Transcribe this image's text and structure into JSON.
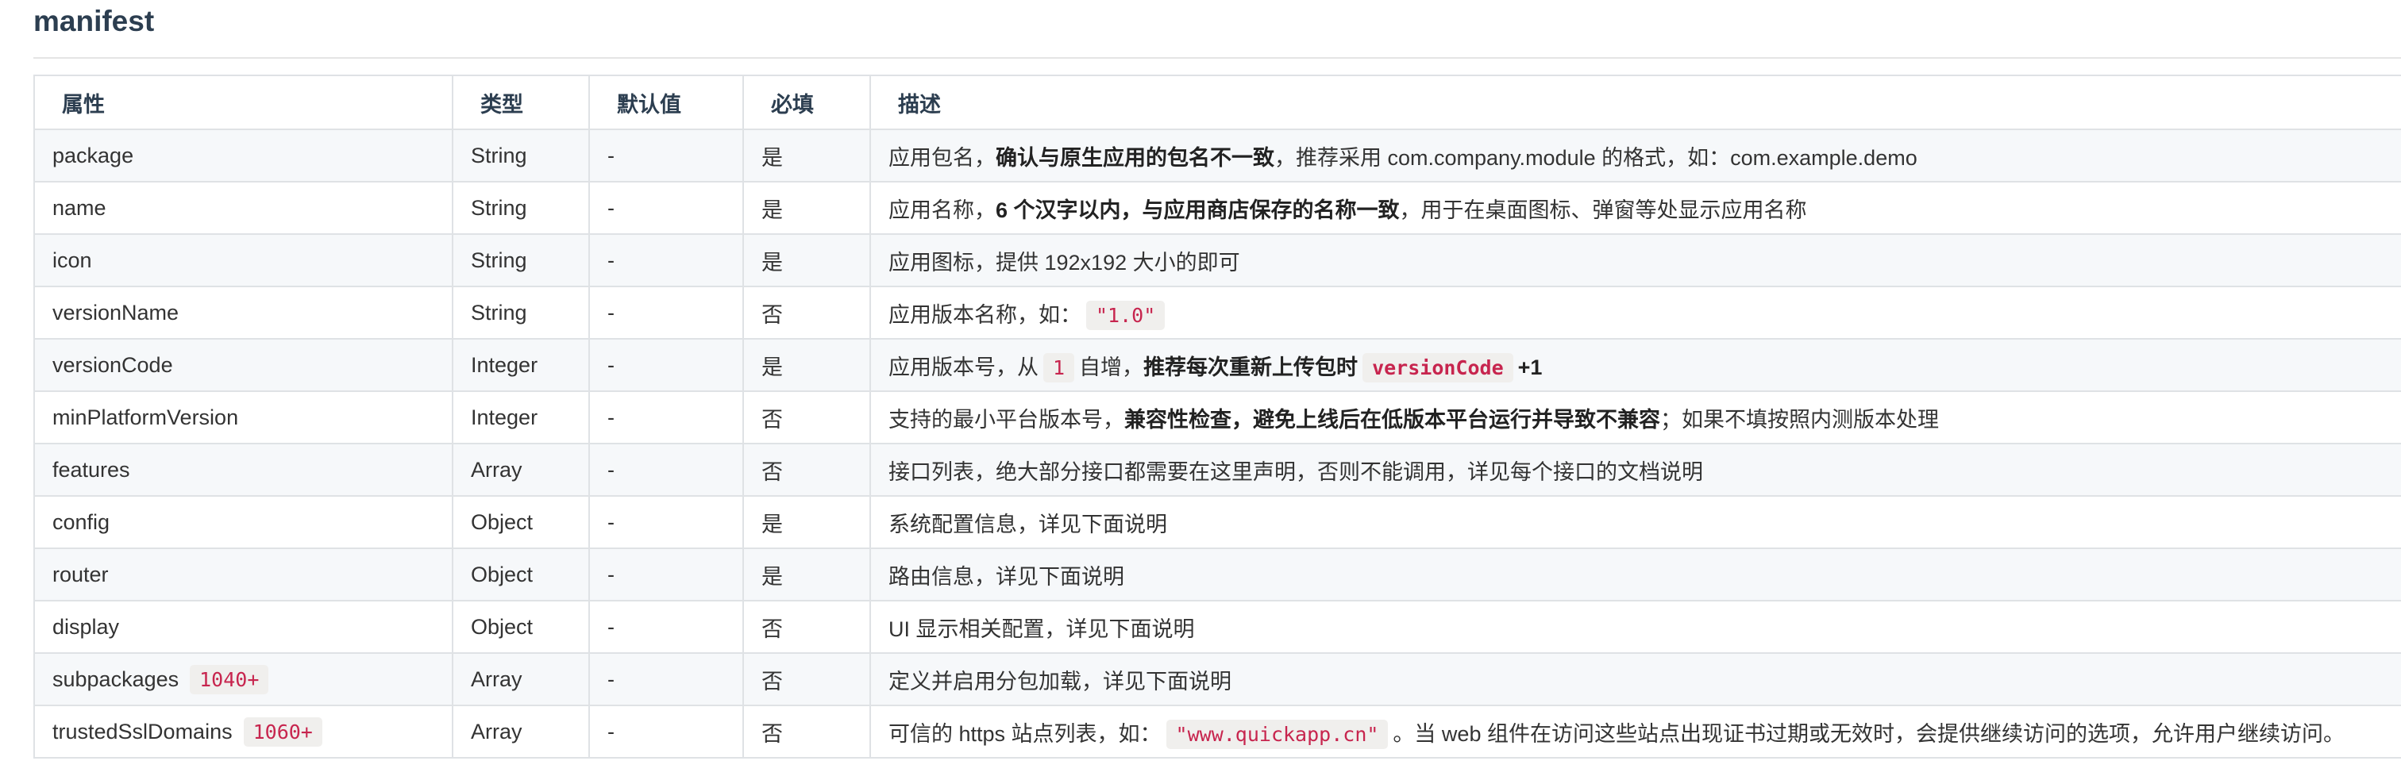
{
  "page": {
    "title": "manifest"
  },
  "table": {
    "headers": [
      "属性",
      "类型",
      "默认值",
      "必填",
      "描述"
    ],
    "rows": [
      {
        "property": "package",
        "type": "String",
        "default": "-",
        "required": "是",
        "desc": [
          {
            "text": "应用包名，"
          },
          {
            "text": "确认与原生应用的包名不一致",
            "bold": true
          },
          {
            "text": "，推荐采用 com.company.module 的格式，如：com.example.demo"
          }
        ]
      },
      {
        "property": "name",
        "type": "String",
        "default": "-",
        "required": "是",
        "desc": [
          {
            "text": "应用名称，"
          },
          {
            "text": "6 个汉字以内，与应用商店保存的名称一致",
            "bold": true
          },
          {
            "text": "，用于在桌面图标、弹窗等处显示应用名称"
          }
        ]
      },
      {
        "property": "icon",
        "type": "String",
        "default": "-",
        "required": "是",
        "desc": [
          {
            "text": "应用图标，提供 192x192 大小的即可"
          }
        ]
      },
      {
        "property": "versionName",
        "type": "String",
        "default": "-",
        "required": "否",
        "desc": [
          {
            "text": "应用版本名称，如："
          },
          {
            "text": "\"1.0\"",
            "code": true
          }
        ]
      },
      {
        "property": "versionCode",
        "type": "Integer",
        "default": "-",
        "required": "是",
        "desc": [
          {
            "text": "应用版本号，从"
          },
          {
            "text": "1",
            "code": true
          },
          {
            "text": "自增，"
          },
          {
            "text": "推荐每次重新上传包时",
            "bold": true
          },
          {
            "text": "versionCode",
            "code": true,
            "bold": true
          },
          {
            "text": "+1",
            "bold": true
          }
        ]
      },
      {
        "property": "minPlatformVersion",
        "type": "Integer",
        "default": "-",
        "required": "否",
        "desc": [
          {
            "text": "支持的最小平台版本号，"
          },
          {
            "text": "兼容性检查，避免上线后在低版本平台运行并导致不兼容",
            "bold": true
          },
          {
            "text": "；如果不填按照内测版本处理"
          }
        ]
      },
      {
        "property": "features",
        "type": "Array",
        "default": "-",
        "required": "否",
        "desc": [
          {
            "text": "接口列表，绝大部分接口都需要在这里声明，否则不能调用，详见每个接口的文档说明"
          }
        ]
      },
      {
        "property": "config",
        "type": "Object",
        "default": "-",
        "required": "是",
        "desc": [
          {
            "text": "系统配置信息，详见下面说明"
          }
        ]
      },
      {
        "property": "router",
        "type": "Object",
        "default": "-",
        "required": "是",
        "desc": [
          {
            "text": "路由信息，详见下面说明"
          }
        ]
      },
      {
        "property": "display",
        "type": "Object",
        "default": "-",
        "required": "否",
        "desc": [
          {
            "text": "UI 显示相关配置，详见下面说明"
          }
        ]
      },
      {
        "property": "subpackages",
        "property_tag": "1040+",
        "type": "Array",
        "default": "-",
        "required": "否",
        "desc": [
          {
            "text": "定义并启用分包加载，详见下面说明"
          }
        ]
      },
      {
        "property": "trustedSslDomains",
        "property_tag": "1060+",
        "type": "Array",
        "default": "-",
        "required": "否",
        "desc": [
          {
            "text": "可信的 https 站点列表，如："
          },
          {
            "text": "\"www.quickapp.cn\"",
            "code": true
          },
          {
            "text": "。当 web 组件在访问这些站点出现证书过期或无效时，会提供继续访问的选项，允许用户继续访问。"
          }
        ]
      }
    ]
  }
}
